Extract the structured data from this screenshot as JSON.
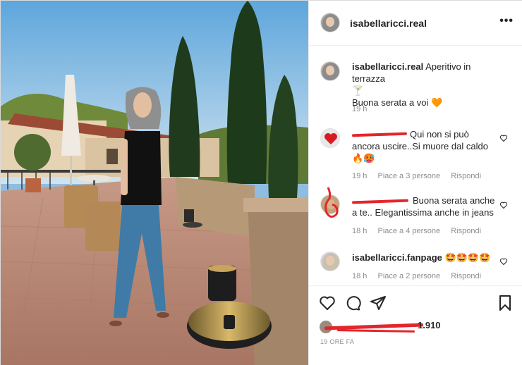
{
  "post": {
    "username": "isabellaricci.real",
    "more_label": "•••"
  },
  "caption": {
    "username": "isabellaricci.real",
    "text": "Aperitivo in terrazza",
    "emoji_1": "🍸",
    "line2": "Buona serata a voi",
    "emoji_2": "🧡",
    "time": "19 h"
  },
  "comments": [
    {
      "username": "",
      "text": "Qui non si può ancora uscire..Si muore dal caldo",
      "emoji": "🔥🥵",
      "time": "19 h",
      "likes": "Piace a 3 persone",
      "reply": "Rispondi"
    },
    {
      "username": "",
      "text": "Buona serata anche a te.. Elegantissima anche in jeans",
      "time": "18 h",
      "likes": "Piace a 4 persone",
      "reply": "Rispondi"
    },
    {
      "username": "isabellaricci.fanpage",
      "text": "",
      "emoji": "🤩🤩🤩🤩",
      "time": "18 h",
      "likes": "Piace a 2 persone",
      "reply": "Rispondi"
    }
  ],
  "footer": {
    "likes_count": "1.910",
    "time_ago": "19 ORE FA"
  },
  "colors": {
    "redaction": "#e3262c",
    "secondary_text": "#8e8e8e",
    "primary_text": "#262626"
  }
}
